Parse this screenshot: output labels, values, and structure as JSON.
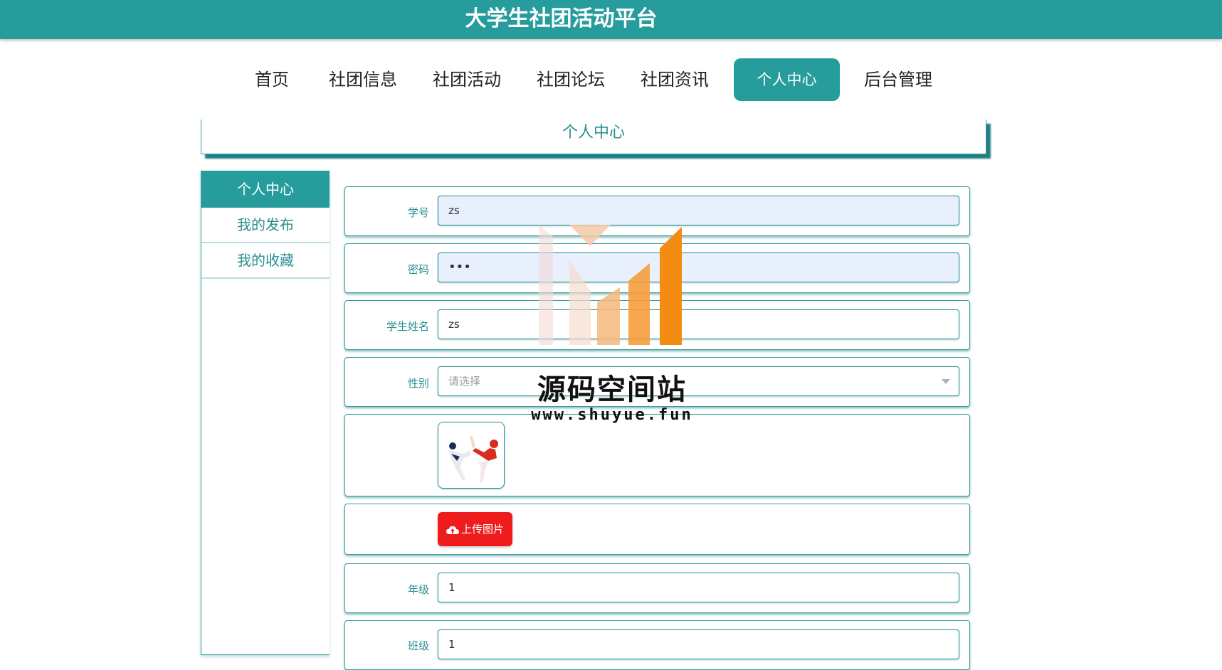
{
  "header": {
    "title": "大学生社团活动平台"
  },
  "nav": {
    "items": [
      {
        "label": "首页"
      },
      {
        "label": "社团信息"
      },
      {
        "label": "社团活动"
      },
      {
        "label": "社团论坛"
      },
      {
        "label": "社团资讯"
      },
      {
        "label": "个人中心"
      },
      {
        "label": "后台管理"
      }
    ],
    "active": "个人中心"
  },
  "section": {
    "title": "个人中心"
  },
  "sidebar": {
    "items": [
      {
        "label": "个人中心"
      },
      {
        "label": "我的发布"
      },
      {
        "label": "我的收藏"
      }
    ]
  },
  "form": {
    "student_id": {
      "label": "学号",
      "value": "zs"
    },
    "password": {
      "label": "密码",
      "value": "•••"
    },
    "student_name": {
      "label": "学生姓名",
      "value": "zs"
    },
    "gender": {
      "label": "性别",
      "placeholder": "请选择"
    },
    "upload_button": "上传图片",
    "grade": {
      "label": "年级",
      "value": "1"
    },
    "class": {
      "label": "班级",
      "value": "1"
    }
  },
  "watermark": {
    "name": "源码空间站",
    "url": "www.shuyue.fun"
  },
  "colors": {
    "primary": "#279c9c",
    "accent_text": "#2a8e92",
    "upload_button": "#ee1c1c",
    "autofill_bg": "#e8f0fe"
  }
}
